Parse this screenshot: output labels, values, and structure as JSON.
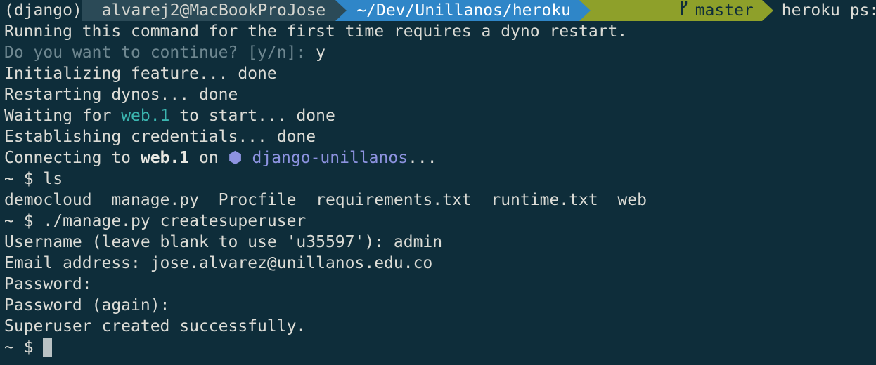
{
  "prompt": {
    "env": "(django)",
    "user_host": "alvarej2@MacBookProJose",
    "cwd": "~/Dev/Unillanos/heroku",
    "branch_icon": "git-branch-icon",
    "branch": "master",
    "command": "heroku ps:exec"
  },
  "output": {
    "line1": "Running this command for the first time requires a dyno restart.",
    "confirm_question": "Do you want to continue? [y/n]:",
    "confirm_answer": "y",
    "line_init": "Initializing feature... done",
    "line_restart": "Restarting dynos... done",
    "waiting_prefix": "Waiting for",
    "waiting_dyno": "web.1",
    "waiting_suffix": "to start... done",
    "line_creds": "Establishing credentials... done",
    "connecting_prefix": "Connecting to",
    "connecting_dyno": "web.1",
    "connecting_on": "on",
    "app_bullet": "⬢",
    "app_name": "django-unillanos",
    "connecting_suffix": "..."
  },
  "session": {
    "ps1": "~ $",
    "cmd_ls": "ls",
    "ls_output": "democloud  manage.py  Procfile  requirements.txt  runtime.txt  web",
    "cmd_create": "./manage.py createsuperuser",
    "username_line": "Username (leave blank to use 'u35597'): admin",
    "email_line": "Email address: jose.alvarez@unillanos.edu.co",
    "password_line": "Password:",
    "password_again_line": "Password (again):",
    "success_line": "Superuser created successfully.",
    "final_prompt": "~ $"
  },
  "colors": {
    "background": "#0e2d3a",
    "user_segment": "#2b4a57",
    "dir_segment": "#2f86c8",
    "branch_segment": "#8ea02a",
    "dyno_highlight": "#3bb6b0",
    "app_highlight": "#8d93e0"
  }
}
